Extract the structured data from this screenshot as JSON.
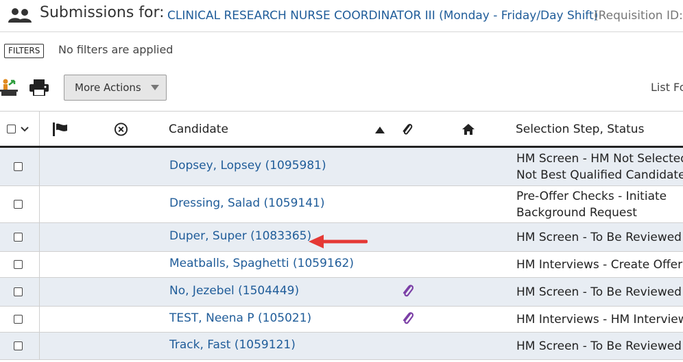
{
  "header": {
    "label": "Submissions for:",
    "job_title": "CLINICAL RESEARCH NURSE COORDINATOR III (Monday - Friday/Day Shift)",
    "requisition": "(Requisition ID:"
  },
  "filters": {
    "badge": "FILTERS",
    "text": "No filters are applied"
  },
  "toolbar": {
    "more_actions": "More Actions",
    "list_format": "List Fo"
  },
  "table": {
    "columns": {
      "candidate": "Candidate",
      "step_status": "Selection Step, Status"
    },
    "rows": [
      {
        "candidate": "Dopsey, Lopsey (1095981)",
        "status_line1": "HM Screen - HM Not Selected",
        "status_line2": "Not Best Qualified Candidate",
        "attachment": false
      },
      {
        "candidate": "Dressing, Salad (1059141)",
        "status_line1": "Pre-Offer Checks - Initiate",
        "status_line2": "Background Request",
        "attachment": false
      },
      {
        "candidate": "Duper, Super (1083365)",
        "status_line1": "HM Screen - To Be Reviewed",
        "status_line2": "",
        "attachment": false
      },
      {
        "candidate": "Meatballs, Spaghetti (1059162)",
        "status_line1": "HM Interviews - Create Offer",
        "status_line2": "",
        "attachment": false
      },
      {
        "candidate": "No, Jezebel (1504449)",
        "status_line1": "HM Screen - To Be Reviewed",
        "status_line2": "",
        "attachment": true
      },
      {
        "candidate": "TEST, Neena P (105021)",
        "status_line1": "HM Interviews - HM Interviews",
        "status_line2": "",
        "attachment": true
      },
      {
        "candidate": "Track, Fast (1059121)",
        "status_line1": "HM Screen - To Be Reviewed",
        "status_line2": "",
        "attachment": false
      }
    ]
  },
  "icons": {
    "header": "people-icon",
    "toolbar": [
      "candidate-move-icon",
      "print-icon"
    ],
    "columns": [
      "select-all-checkbox",
      "chevron-down-icon",
      "flag-icon",
      "circle-x-icon",
      "sort-ascending-icon",
      "paperclip-icon",
      "home-icon"
    ],
    "annotation": "red-arrow"
  },
  "colors": {
    "link": "#1f5c99",
    "row_alt": "#e8edf3",
    "attachment": "#7b3fa6",
    "arrow": "#e53935"
  }
}
